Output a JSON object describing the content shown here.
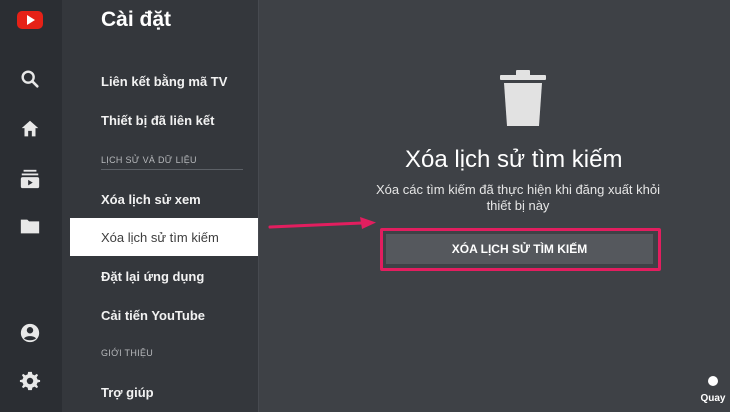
{
  "app": {
    "brand_icon": "youtube-logo"
  },
  "nav_rail": {
    "items": [
      {
        "icon": "search-icon"
      },
      {
        "icon": "home-icon"
      },
      {
        "icon": "subscriptions-icon"
      },
      {
        "icon": "library-folder-icon"
      },
      {
        "icon": "account-icon"
      },
      {
        "icon": "settings-gear-icon"
      }
    ]
  },
  "settings": {
    "title": "Cài đặt",
    "items": [
      {
        "label": "Liên kết bằng mã TV"
      },
      {
        "label": "Thiết bị đã liên kết"
      }
    ],
    "section_history": "LỊCH SỬ VÀ DỮ LIỆU",
    "history_items": [
      {
        "label": "Xóa lịch sử xem"
      },
      {
        "label": "Xóa lịch sử tìm kiếm",
        "selected": true
      },
      {
        "label": "Đặt lại ứng dụng"
      },
      {
        "label": "Cải tiến YouTube"
      }
    ],
    "section_about": "GIỚI THIỆU",
    "about_items": [
      {
        "label": "Trợ giúp"
      }
    ]
  },
  "detail": {
    "icon": "trash-icon",
    "title": "Xóa lịch sử tìm kiếm",
    "description": "Xóa các tìm kiếm đã thực hiện khi đăng xuất khỏi thiết bị này",
    "button_label": "XÓA LỊCH SỬ TÌM KIẾM"
  },
  "annotation": {
    "color": "#e21e5f"
  },
  "footer": {
    "back_label": "Quay"
  }
}
